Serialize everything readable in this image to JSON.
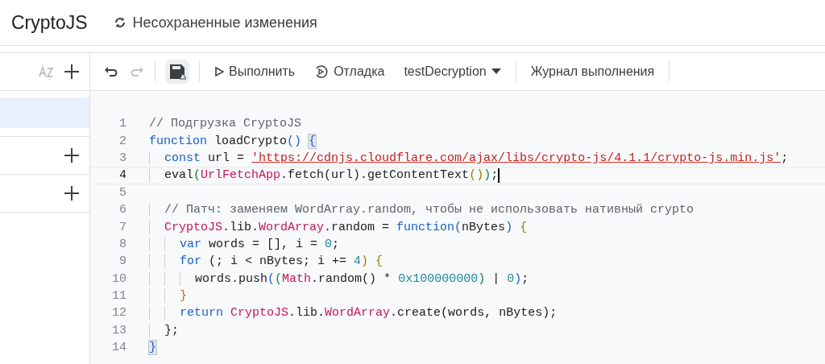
{
  "header": {
    "title": "CryptoJS",
    "status": "Несохраненные изменения"
  },
  "sidebar": {
    "files": [
      {
        "selected": true
      }
    ],
    "sections": [
      {
        "kind": "add"
      },
      {
        "kind": "add"
      }
    ]
  },
  "toolbar": {
    "undo_disabled": false,
    "redo_disabled": true,
    "run": "Выполнить",
    "debug": "Отладка",
    "function": "testDecryption",
    "log": "Журнал выполнения"
  },
  "editor": {
    "lines": [
      {
        "number": "1",
        "current": false,
        "tokens": [
          {
            "kind": "comment",
            "text": "// Подгрузка CryptoJS"
          }
        ]
      },
      {
        "number": "2",
        "current": false,
        "tokens": [
          {
            "kind": "keyword",
            "text": "function"
          },
          {
            "kind": "plain",
            "text": " loadCrypto"
          },
          {
            "kind": "paren",
            "text": "()"
          },
          {
            "kind": "match",
            "text": " {"
          }
        ]
      },
      {
        "number": "3",
        "current": false,
        "tokens": [
          {
            "kind": "keyword",
            "text": "  const"
          },
          {
            "kind": "plain",
            "text": " url = "
          },
          {
            "kind": "string",
            "text": "'https://cdnjs.cloudflare.com/ajax/libs/crypto-js/4.1.1/crypto-js.min.js'"
          },
          {
            "kind": "plain",
            "text": ";"
          }
        ]
      },
      {
        "number": "4",
        "current": true,
        "tokens": [
          {
            "kind": "plain",
            "text": "  eval"
          },
          {
            "kind": "paren2",
            "text": "("
          },
          {
            "kind": "type",
            "text": "UrlFetchApp"
          },
          {
            "kind": "plain",
            "text": ".fetch(url).getContentText"
          },
          {
            "kind": "paren3",
            "text": "()"
          },
          {
            "kind": "paren2",
            "text": ")"
          },
          {
            "kind": "plain",
            "text": ";"
          }
        ]
      },
      {
        "number": "5",
        "current": false
      },
      {
        "number": "6",
        "current": false,
        "tokens": [
          {
            "kind": "comment",
            "text": "  // Патч: заменяем WordArray.random, чтобы не использовать нативный crypto"
          }
        ]
      },
      {
        "number": "7",
        "current": false,
        "tokens": [
          {
            "kind": "type",
            "text": "  CryptoJS"
          },
          {
            "kind": "plain",
            "text": ".lib."
          },
          {
            "kind": "type",
            "text": "WordArray"
          },
          {
            "kind": "plain",
            "text": ".random = "
          },
          {
            "kind": "keyword",
            "text": "function"
          },
          {
            "kind": "paren",
            "text": "("
          },
          {
            "kind": "plain",
            "text": "nBytes"
          },
          {
            "kind": "paren",
            "text": ")"
          },
          {
            "kind": "paren3",
            "text": " {"
          }
        ]
      },
      {
        "number": "8",
        "current": false,
        "tokens": [
          {
            "kind": "keyword",
            "text": "    var"
          },
          {
            "kind": "plain",
            "text": " words = [], i = "
          },
          {
            "kind": "number",
            "text": "0"
          },
          {
            "kind": "plain",
            "text": ";"
          }
        ]
      },
      {
        "number": "9",
        "current": false,
        "tokens": [
          {
            "kind": "keyword",
            "text": "    for"
          },
          {
            "kind": "plain",
            "text": " (; i < nBytes; i += "
          },
          {
            "kind": "number",
            "text": "4"
          },
          {
            "kind": "paren3",
            "text": ") {"
          }
        ]
      },
      {
        "number": "10",
        "current": false,
        "tokens": [
          {
            "kind": "plain",
            "text": "      words.push"
          },
          {
            "kind": "paren",
            "text": "("
          },
          {
            "kind": "paren2",
            "text": "("
          },
          {
            "kind": "type",
            "text": "Math"
          },
          {
            "kind": "plain",
            "text": ".random() * "
          },
          {
            "kind": "number",
            "text": "0x100000000"
          },
          {
            "kind": "paren2",
            "text": ")"
          },
          {
            "kind": "plain",
            "text": " | "
          },
          {
            "kind": "number",
            "text": "0"
          },
          {
            "kind": "paren",
            "text": ")"
          },
          {
            "kind": "plain",
            "text": ";"
          }
        ]
      },
      {
        "number": "11",
        "current": false,
        "tokens": [
          {
            "kind": "paren3",
            "text": "    }"
          }
        ]
      },
      {
        "number": "12",
        "current": false,
        "tokens": [
          {
            "kind": "keyword",
            "text": "    return"
          },
          {
            "kind": "type",
            "text": " CryptoJS"
          },
          {
            "kind": "plain",
            "text": ".lib."
          },
          {
            "kind": "type",
            "text": "WordArray"
          },
          {
            "kind": "plain",
            "text": ".create(words, nBytes);"
          }
        ]
      },
      {
        "number": "13",
        "current": false,
        "tokens": [
          {
            "kind": "plain",
            "text": "  };"
          }
        ]
      },
      {
        "number": "14",
        "current": false,
        "tokens": [
          {
            "kind": "match",
            "text": "}"
          }
        ]
      }
    ]
  }
}
